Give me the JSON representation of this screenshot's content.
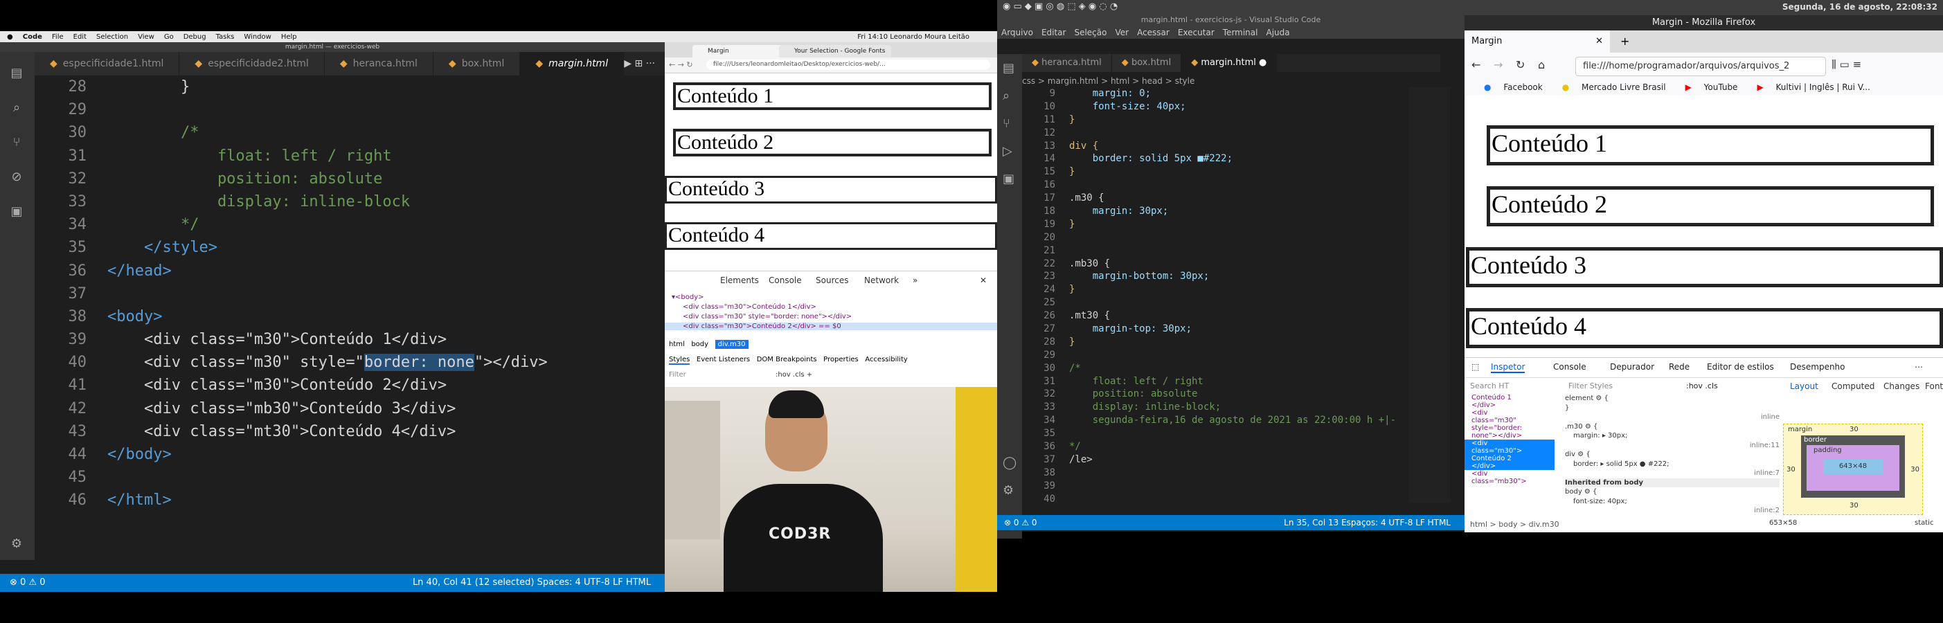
{
  "left": {
    "menubar": [
      "Code",
      "File",
      "Edit",
      "Selection",
      "View",
      "Go",
      "Debug",
      "Tasks",
      "Window",
      "Help"
    ],
    "menubar_right": "Fri 14:10  Leonardo Moura Leitão",
    "window_title": "margin.html — exercicios-web",
    "tabs": [
      "especificidade1.html",
      "especificidade2.html",
      "heranca.html",
      "box.html",
      "margin.html"
    ],
    "code_lines": [
      {
        "n": "28",
        "text": "        }"
      },
      {
        "n": "29",
        "text": ""
      },
      {
        "n": "30",
        "text": "        /*"
      },
      {
        "n": "31",
        "text": "            float: left / right"
      },
      {
        "n": "32",
        "text": "            position: absolute"
      },
      {
        "n": "33",
        "text": "            display: inline-block"
      },
      {
        "n": "34",
        "text": "        */"
      },
      {
        "n": "35",
        "text": "    </style>"
      },
      {
        "n": "36",
        "text": "</head>"
      },
      {
        "n": "37",
        "text": ""
      },
      {
        "n": "38",
        "text": "<body>"
      },
      {
        "n": "39",
        "text": "    <div class=\"m30\">Conteúdo 1</div>"
      },
      {
        "n": "40",
        "text": "    <div class=\"m30\" style=\"border: none\"></div>"
      },
      {
        "n": "41",
        "text": "    <div class=\"m30\">Conteúdo 2</div>"
      },
      {
        "n": "42",
        "text": "    <div class=\"mb30\">Conteúdo 3</div>"
      },
      {
        "n": "43",
        "text": "    <div class=\"mt30\">Conteúdo 4</div>"
      },
      {
        "n": "44",
        "text": "</body>"
      },
      {
        "n": "45",
        "text": ""
      },
      {
        "n": "46",
        "text": "</html>"
      }
    ],
    "status_left": "⊗ 0  ⚠ 0",
    "status_right": "Ln 40, Col 41 (12 selected)    Spaces: 4    UTF-8    LF    HTML",
    "chrome": {
      "tab1": "Margin",
      "tab2": "Your Selection - Google Fonts",
      "url": "file:///Users/leonardomleitao/Desktop/exercicios-web/...",
      "boxes": [
        "Conteúdo 1",
        "Conteúdo 2",
        "Conteúdo 3",
        "Conteúdo 4"
      ],
      "devtools_tabs": [
        "Elements",
        "Console",
        "Sources",
        "Network",
        "»"
      ],
      "dom_lines": [
        "▾<body>",
        "<div class=\"m30\">Conteúdo 1</div>",
        "<div class=\"m30\" style=\"border: none\"></div>",
        "<div class=\"m30\">Conteúdo 2</div> == $0"
      ],
      "crumbs": [
        "html",
        "body",
        "div.m30"
      ],
      "style_tabs": [
        "Styles",
        "Event Listeners",
        "DOM Breakpoints",
        "Properties",
        "Accessibility"
      ],
      "filter": "Filter",
      "filter_right": ":hov .cls +"
    },
    "shirt_logo": "COD3R"
  },
  "right": {
    "topbar_right": "Segunda, 16 de agosto, 22:08:32",
    "vscode_title": "margin.html - exercicios-js - Visual Studio Code",
    "vscode_menu": [
      "Arquivo",
      "Editar",
      "Seleção",
      "Ver",
      "Acessar",
      "Executar",
      "Terminal",
      "Ajuda"
    ],
    "tabs": [
      "heranca.html",
      "box.html",
      "margin.html"
    ],
    "breadcrumb": "css > margin.html > html > head > style",
    "code_lines": [
      {
        "n": "9",
        "text": "    margin: 0;"
      },
      {
        "n": "10",
        "text": "    font-size: 40px;"
      },
      {
        "n": "11",
        "text": "}"
      },
      {
        "n": "12",
        "text": ""
      },
      {
        "n": "13",
        "text": "div {"
      },
      {
        "n": "14",
        "text": "    border: solid 5px ■#222;"
      },
      {
        "n": "15",
        "text": "}"
      },
      {
        "n": "16",
        "text": ""
      },
      {
        "n": "17",
        "text": ".m30 {"
      },
      {
        "n": "18",
        "text": "    margin: 30px;"
      },
      {
        "n": "19",
        "text": "}"
      },
      {
        "n": "20",
        "text": ""
      },
      {
        "n": "21",
        "text": ""
      },
      {
        "n": "22",
        "text": ".mb30 {"
      },
      {
        "n": "23",
        "text": "    margin-bottom: 30px;"
      },
      {
        "n": "24",
        "text": "}"
      },
      {
        "n": "25",
        "text": ""
      },
      {
        "n": "26",
        "text": ".mt30 {"
      },
      {
        "n": "27",
        "text": "    margin-top: 30px;"
      },
      {
        "n": "28",
        "text": "}"
      },
      {
        "n": "29",
        "text": ""
      },
      {
        "n": "30",
        "text": "/*"
      },
      {
        "n": "31",
        "text": "    float: left / right"
      },
      {
        "n": "32",
        "text": "    position: absolute"
      },
      {
        "n": "33",
        "text": "    display: inline-block;"
      },
      {
        "n": "34",
        "text": "    segunda-feira,16 de agosto de 2021 as 22:00:00 h +|-"
      },
      {
        "n": "35",
        "text": ""
      },
      {
        "n": "36",
        "text": "*/"
      },
      {
        "n": "37",
        "text": "/le>"
      },
      {
        "n": "38",
        "text": ""
      },
      {
        "n": "39",
        "text": ""
      },
      {
        "n": "40",
        "text": ""
      }
    ],
    "status_left": "⊗ 0 ⚠ 0",
    "status_right": "Ln 35, Col 13   Espaços: 4   UTF-8   LF   HTML",
    "firefox": {
      "title": "Margin - Mozilla Firefox",
      "tab": "Margin",
      "url": "file:///home/programador/arquivos/arquivos_2",
      "bookmarks": [
        "Facebook",
        "Mercado Livre Brasil",
        "YouTube",
        "Kultivi | Inglês | Rui V..."
      ],
      "boxes": [
        "Conteúdo 1",
        "Conteúdo 2",
        "Conteúdo 3",
        "Conteúdo 4"
      ],
      "devtools_tabs": [
        "Inspetor",
        "Console",
        "Depurador",
        "Rede",
        "Editor de estilos",
        "Desempenho"
      ],
      "search_html": "Search HT",
      "filter_styles": "Filter Styles",
      "hov_cls": ":hov .cls",
      "layout_tabs": [
        "Layout",
        "Computed",
        "Changes",
        "Fonts"
      ],
      "rules": [
        "element ⚙ {",
        "}",
        "inline",
        ".m30 ⚙ {",
        "margin: ▸ 30px;",
        "inline:11",
        "div ⚙ {",
        "border: ▸ solid 5px ● #222;",
        "inline:7",
        "Inherited from body",
        "body ⚙ {",
        "font-size: 40px;",
        "inline:2"
      ],
      "dom_lines": [
        "Conteúdo 1",
        "</div>",
        "<div",
        "class=\"m30\"",
        "style=\"border:",
        "none\"></div>",
        "<div",
        "class=\"m30\">",
        "Conteúdo 2",
        "</div>",
        "<div",
        "class=\"mb30\">"
      ],
      "crumbs": "html > body > div.m30",
      "boxmodel": {
        "margin": "margin",
        "border": "border",
        "padding": "padding",
        "size": "643×48",
        "m": "30",
        "b": "5",
        "p": "0",
        "dims": "653×58",
        "pos": "static"
      }
    }
  }
}
